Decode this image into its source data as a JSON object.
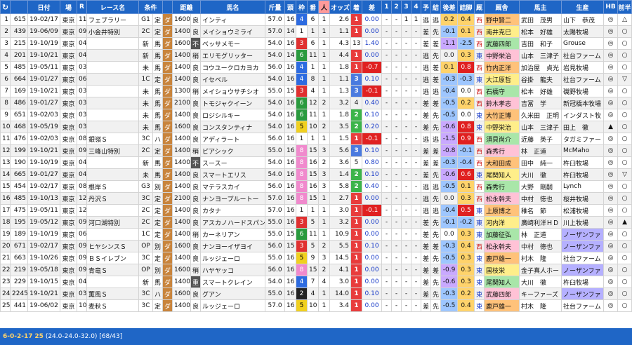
{
  "header": {
    "refresh_icon": "refresh-icon",
    "columns": [
      "",
      "",
      "日付",
      "場",
      "R",
      "レース名",
      "条件",
      "",
      "距離",
      "",
      "馬名",
      "斤量",
      "頭",
      "枠",
      "番",
      "人",
      "オッズ",
      "着",
      "差",
      "1",
      "2",
      "3",
      "4",
      "予",
      "結",
      "後差",
      "詰脚",
      "厩",
      "厩舎",
      "",
      "馬主",
      "生産",
      "HB",
      "前半",
      "後半"
    ]
  },
  "rows": [
    {
      "no": "1",
      "id": "615",
      "date": "19-02/17",
      "place": "東京",
      "r": "11",
      "race": "フェブラリー",
      "grade": "G1",
      "cond": "定",
      "surf": "ダ",
      "dist": "1600",
      "ba": "良",
      "name": "インティ",
      "kin": "57.0",
      "tou": "16",
      "waku": "4",
      "ban": "6",
      "nin": "1",
      "odds": "2.6",
      "chaku": "1",
      "sa": "0.00",
      "c1": "-",
      "c2": "-",
      "c3": "1",
      "c4": "1",
      "yo": "逃",
      "ke": "逃",
      "atosa": "0.2",
      "tsume": "0.4",
      "kyu": "西",
      "trainer": "野中賢二",
      "owner": "武田　茂男",
      "breeder": "山下　恭茂",
      "hb": "◎",
      "mae": "△",
      "ato": "▽"
    },
    {
      "no": "2",
      "id": "439",
      "date": "19-06/09",
      "place": "東京",
      "r": "09",
      "race": "小金井特別",
      "grade": "2C",
      "cond": "定",
      "surf": "ダ",
      "dist": "1400",
      "ba": "良",
      "name": "メイショウミライ",
      "kin": "57.0",
      "tou": "14",
      "waku": "1",
      "ban": "1",
      "nin": "1",
      "odds": "1.1",
      "chaku": "1",
      "sa": "0.00",
      "c1": "-",
      "c2": "-",
      "c3": "-",
      "c4": "-",
      "yo": "差",
      "ke": "先",
      "atosa": "-0.1",
      "tsume": "0.1",
      "kyu": "西",
      "trainer": "南井克巳",
      "owner": "松本　好雄",
      "breeder": "太陽牧場",
      "hb": "◎",
      "mae": "○",
      "ato": "▽"
    },
    {
      "no": "3",
      "id": "215",
      "date": "19-10/19",
      "place": "東京",
      "r": "04",
      "race": "",
      "grade": "新",
      "cond": "馬",
      "surf": "ダ",
      "dist": "1600",
      "ba": "不",
      "name": "ベッサメモー",
      "kin": "54.0",
      "tou": "16",
      "waku": "3",
      "ban": "6",
      "nin": "1",
      "odds": "4.3",
      "chaku": "13",
      "sa": "1.40",
      "c1": "-",
      "c2": "-",
      "c3": "-",
      "c4": "-",
      "yo": "差",
      "ke": "差",
      "atosa": "-1.1",
      "tsume": "-2.5",
      "kyu": "西",
      "trainer": "武藤四郎",
      "owner": "吉田　和子",
      "breeder": "Grouse",
      "hb": "◎",
      "mae": "○",
      "ato": "○"
    },
    {
      "no": "4",
      "id": "201",
      "date": "19-10/21",
      "place": "東京",
      "r": "04",
      "race": "",
      "grade": "新",
      "cond": "馬",
      "surf": "ダ",
      "dist": "1400",
      "ba": "稍",
      "name": "エリモグリッター",
      "kin": "54.0",
      "tou": "14",
      "waku": "6",
      "ban": "11",
      "nin": "1",
      "odds": "4.4",
      "chaku": "1",
      "sa": "0.00",
      "c1": "-",
      "c2": "-",
      "c3": "-",
      "c4": "-",
      "yo": "逃",
      "ke": "先",
      "atosa": "0.0",
      "tsume": "0.3",
      "kyu": "東",
      "trainer": "中野栄治",
      "owner": "山本　三津子",
      "breeder": "社台ファーム",
      "hb": "◎",
      "mae": "○",
      "ato": "○"
    },
    {
      "no": "5",
      "id": "485",
      "date": "19-05/11",
      "place": "東京",
      "r": "03",
      "race": "",
      "grade": "未",
      "cond": "馬",
      "surf": "ダ",
      "dist": "1400",
      "ba": "良",
      "name": "コウユークロカヨカ",
      "kin": "56.0",
      "tou": "16",
      "waku": "4",
      "ban": "1",
      "nin": "1",
      "odds": "1.8",
      "chaku": "1",
      "sa": "-0.7",
      "c1": "-",
      "c2": "-",
      "c3": "-",
      "c4": "-",
      "yo": "逃",
      "ke": "差",
      "atosa": "0.1",
      "tsume": "0.8",
      "kyu": "西",
      "trainer": "竹内正洋",
      "owner": "加治屋　貞光",
      "breeder": "岩見牧場",
      "hb": "◎",
      "mae": "○",
      "ato": "○"
    },
    {
      "no": "6",
      "id": "664",
      "date": "19-01/27",
      "place": "東京",
      "r": "06",
      "race": "",
      "grade": "1C",
      "cond": "定",
      "surf": "ダ",
      "dist": "1400",
      "ba": "良",
      "name": "イセベル",
      "kin": "54.0",
      "tou": "16",
      "waku": "4",
      "ban": "8",
      "nin": "1",
      "odds": "1.1",
      "chaku": "3",
      "sa": "0.10",
      "c1": "-",
      "c2": "-",
      "c3": "-",
      "c4": "-",
      "yo": "逃",
      "ke": "差",
      "atosa": "-0.3",
      "tsume": "-0.3",
      "kyu": "東",
      "trainer": "大江原哲",
      "owner": "谷掛　龍夫",
      "breeder": "社台ファーム",
      "hb": "◎",
      "mae": "▽",
      "ato": "○"
    },
    {
      "no": "7",
      "id": "169",
      "date": "19-10/21",
      "place": "東京",
      "r": "03",
      "race": "",
      "grade": "未",
      "cond": "馬",
      "surf": "ダ",
      "dist": "1300",
      "ba": "稍",
      "name": "メイショウサチシオ",
      "kin": "55.0",
      "tou": "15",
      "waku": "3",
      "ban": "4",
      "nin": "1",
      "odds": "1.3",
      "chaku": "3",
      "sa": "-0.1",
      "c1": "-",
      "c2": "-",
      "c3": "-",
      "c4": "-",
      "yo": "逃",
      "ke": "逃",
      "atosa": "-0.4",
      "tsume": "0.0",
      "kyu": "西",
      "trainer": "石橋守",
      "owner": "松本　好雄",
      "breeder": "磯野牧場",
      "hb": "◎",
      "mae": "○",
      "ato": "○"
    },
    {
      "no": "8",
      "id": "486",
      "date": "19-01/27",
      "place": "東京",
      "r": "03",
      "race": "",
      "grade": "未",
      "cond": "馬",
      "surf": "ダ",
      "dist": "2100",
      "ba": "良",
      "name": "トモジャクイーン",
      "kin": "54.0",
      "tou": "16",
      "waku": "6",
      "ban": "12",
      "nin": "2",
      "odds": "3.2",
      "chaku": "4",
      "sa": "0.40",
      "c1": "-",
      "c2": "-",
      "c3": "-",
      "c4": "-",
      "yo": "差",
      "ke": "差",
      "atosa": "-0.5",
      "tsume": "0.2",
      "kyu": "西",
      "trainer": "鈴木孝志",
      "owner": "吉冨　学",
      "breeder": "新冠橋本牧場",
      "hb": "◎",
      "mae": "○",
      "ato": "▲"
    },
    {
      "no": "9",
      "id": "651",
      "date": "19-02/03",
      "place": "東京",
      "r": "03",
      "race": "",
      "grade": "未",
      "cond": "馬",
      "surf": "ダ",
      "dist": "1400",
      "ba": "良",
      "name": "ロジシルキー",
      "kin": "54.0",
      "tou": "16",
      "waku": "6",
      "ban": "11",
      "nin": "1",
      "odds": "1.8",
      "chaku": "2",
      "sa": "0.10",
      "c1": "-",
      "c2": "-",
      "c3": "-",
      "c4": "-",
      "yo": "差",
      "ke": "先",
      "atosa": "-0.5",
      "tsume": "0.0",
      "kyu": "東",
      "trainer": "大竹正博",
      "owner": "久米田　正明",
      "breeder": "インダスト牧",
      "hb": "◎",
      "mae": "○",
      "ato": "▽"
    },
    {
      "no": "10",
      "id": "468",
      "date": "19-05/19",
      "place": "東京",
      "r": "03",
      "race": "",
      "grade": "未",
      "cond": "馬",
      "surf": "ダ",
      "dist": "1600",
      "ba": "良",
      "name": "コンスタンティナ",
      "kin": "54.0",
      "tou": "16",
      "waku": "5",
      "ban": "10",
      "nin": "2",
      "odds": "3.5",
      "chaku": "2",
      "sa": "0.20",
      "c1": "-",
      "c2": "-",
      "c3": "-",
      "c4": "-",
      "yo": "差",
      "ke": "先",
      "atosa": "-0.6",
      "tsume": "0.8",
      "kyu": "東",
      "trainer": "中野栄治",
      "owner": "山本　三津子",
      "breeder": "田上　徹",
      "hb": "▲",
      "mae": "○",
      "ato": "▲"
    },
    {
      "no": "11",
      "id": "476",
      "date": "19-02/03",
      "place": "東京",
      "r": "08",
      "race": "銀嶺Ｓ",
      "grade": "3C",
      "cond": "ハ",
      "surf": "ダ",
      "dist": "1400",
      "ba": "良",
      "name": "アディラート",
      "kin": "56.0",
      "tou": "16",
      "waku": "1",
      "ban": "1",
      "nin": "1",
      "odds": "1.5",
      "chaku": "1",
      "sa": "-0.1",
      "c1": "-",
      "c2": "-",
      "c3": "-",
      "c4": "-",
      "yo": "逃",
      "ke": "逃",
      "atosa": "-1.5",
      "tsume": "0.9",
      "kyu": "西",
      "trainer": "須貝尚介",
      "owner": "近藤　英子",
      "breeder": "タガミファー",
      "hb": "◎",
      "mae": "○",
      "ato": "▽"
    },
    {
      "no": "12",
      "id": "199",
      "date": "19-10/21",
      "place": "東京",
      "r": "09",
      "race": "三峰山特別",
      "grade": "2C",
      "cond": "定",
      "surf": "ダ",
      "dist": "1400",
      "ba": "稍",
      "name": "ピアシック",
      "kin": "55.0",
      "tou": "16",
      "waku": "8",
      "ban": "15",
      "nin": "3",
      "odds": "5.6",
      "chaku": "3",
      "sa": "0.10",
      "c1": "-",
      "c2": "-",
      "c3": "-",
      "c4": "-",
      "yo": "差",
      "ke": "差",
      "atosa": "-0.8",
      "tsume": "-0.1",
      "kyu": "西",
      "trainer": "森秀行",
      "owner": "林　正道",
      "breeder": "McMaho",
      "hb": "◎",
      "mae": "○",
      "ato": "○"
    },
    {
      "no": "13",
      "id": "190",
      "date": "19-10/19",
      "place": "東京",
      "r": "04",
      "race": "",
      "grade": "新",
      "cond": "馬",
      "surf": "ダ",
      "dist": "1400",
      "ba": "不",
      "name": "スースー",
      "kin": "54.0",
      "tou": "16",
      "waku": "8",
      "ban": "16",
      "nin": "2",
      "odds": "3.6",
      "chaku": "5",
      "sa": "0.80",
      "c1": "-",
      "c2": "-",
      "c3": "-",
      "c4": "-",
      "yo": "差",
      "ke": "差",
      "atosa": "-0.3",
      "tsume": "-0.4",
      "kyu": "西",
      "trainer": "大和田成",
      "owner": "田中　純一",
      "breeder": "杵臼牧場",
      "hb": "◎",
      "mae": "○",
      "ato": "○"
    },
    {
      "no": "14",
      "id": "665",
      "date": "19-01/27",
      "place": "東京",
      "r": "04",
      "race": "",
      "grade": "未",
      "cond": "馬",
      "surf": "ダ",
      "dist": "1400",
      "ba": "良",
      "name": "スマートエリス",
      "kin": "54.0",
      "tou": "16",
      "waku": "8",
      "ban": "15",
      "nin": "3",
      "odds": "1.4",
      "chaku": "2",
      "sa": "0.10",
      "c1": "-",
      "c2": "-",
      "c3": "-",
      "c4": "-",
      "yo": "差",
      "ke": "先",
      "atosa": "-0.6",
      "tsume": "0.6",
      "kyu": "東",
      "trainer": "尾関知人",
      "owner": "大川　徹",
      "breeder": "杵臼牧場",
      "hb": "◎",
      "mae": "▽",
      "ato": "▲"
    },
    {
      "no": "15",
      "id": "454",
      "date": "19-02/17",
      "place": "東京",
      "r": "08",
      "race": "根岸Ｓ",
      "grade": "G3",
      "cond": "別",
      "surf": "ダ",
      "dist": "1400",
      "ba": "良",
      "name": "マテラスカイ",
      "kin": "56.0",
      "tou": "16",
      "waku": "8",
      "ban": "16",
      "nin": "3",
      "odds": "5.8",
      "chaku": "2",
      "sa": "0.40",
      "c1": "-",
      "c2": "-",
      "c3": "-",
      "c4": "-",
      "yo": "逃",
      "ke": "逃",
      "atosa": "-0.5",
      "tsume": "0.1",
      "kyu": "西",
      "trainer": "森秀行",
      "owner": "大野　剛嗣",
      "breeder": "Lynch",
      "hb": "◎",
      "mae": "○",
      "ato": "○"
    },
    {
      "no": "16",
      "id": "485",
      "date": "19-10/13",
      "place": "東京",
      "r": "12",
      "race": "丹沢Ｓ",
      "grade": "3C",
      "cond": "定",
      "surf": "ダ",
      "dist": "2100",
      "ba": "良",
      "name": "ナンヨープルートー",
      "kin": "57.0",
      "tou": "16",
      "waku": "8",
      "ban": "15",
      "nin": "1",
      "odds": "2.7",
      "chaku": "1",
      "sa": "0.00",
      "c1": "-",
      "c2": "-",
      "c3": "-",
      "c4": "-",
      "yo": "逃",
      "ke": "先",
      "atosa": "0.0",
      "tsume": "0.3",
      "kyu": "西",
      "trainer": "松永幹夫",
      "owner": "中村　徳也",
      "breeder": "桜井牧場",
      "hb": "◎",
      "mae": "○",
      "ato": "○"
    },
    {
      "no": "17",
      "id": "475",
      "date": "19-05/11",
      "place": "東京",
      "r": "12",
      "race": "",
      "grade": "2C",
      "cond": "定",
      "surf": "ダ",
      "dist": "1400",
      "ba": "良",
      "name": "カタナ",
      "kin": "57.0",
      "tou": "16",
      "waku": "1",
      "ban": "1",
      "nin": "1",
      "odds": "3.0",
      "chaku": "1",
      "sa": "-0.1",
      "c1": "-",
      "c2": "-",
      "c3": "-",
      "c4": "-",
      "yo": "逃",
      "ke": "逃",
      "atosa": "-0.4",
      "tsume": "0.5",
      "kyu": "東",
      "trainer": "上原博之",
      "owner": "稚名　節",
      "breeder": "松浦牧場",
      "hb": "◎",
      "mae": "○",
      "ato": "○"
    },
    {
      "no": "18",
      "id": "195",
      "date": "19-05/12",
      "place": "東京",
      "r": "09",
      "race": "河口湖特別",
      "grade": "2C",
      "cond": "定",
      "surf": "ダ",
      "dist": "1400",
      "ba": "良",
      "name": "アスカノハードスパン",
      "kin": "55.0",
      "tou": "16",
      "waku": "3",
      "ban": "5",
      "nin": "1",
      "odds": "3.2",
      "chaku": "1",
      "sa": "0.00",
      "c1": "-",
      "c2": "-",
      "c3": "-",
      "c4": "-",
      "yo": "差",
      "ke": "先",
      "atosa": "-0.1",
      "tsume": "-0.2",
      "kyu": "東",
      "trainer": "河内洋",
      "owner": "廣崎利洋ＨＤ",
      "breeder": "川上牧場",
      "hb": "◎",
      "mae": "▲",
      "ato": "▽"
    },
    {
      "no": "19",
      "id": "189",
      "date": "19-10/19",
      "place": "東京",
      "r": "06",
      "race": "",
      "grade": "1C",
      "cond": "定",
      "surf": "ダ",
      "dist": "1400",
      "ba": "稍",
      "name": "カーネリアン",
      "kin": "55.0",
      "tou": "15",
      "waku": "6",
      "ban": "11",
      "nin": "1",
      "odds": "10.9",
      "chaku": "1",
      "sa": "0.00",
      "c1": "-",
      "c2": "-",
      "c3": "-",
      "c4": "-",
      "yo": "差",
      "ke": "先",
      "atosa": "0.0",
      "tsume": "0.3",
      "kyu": "東",
      "trainer": "加藤征弘",
      "owner": "林　正道",
      "breeder": "ノーザンファ",
      "hb": "◎",
      "mae": "○",
      "ato": "▲"
    },
    {
      "no": "20",
      "id": "671",
      "date": "19-02/17",
      "place": "東京",
      "r": "09",
      "race": "ヒヤシンスＳ",
      "grade": "OP",
      "cond": "別",
      "surf": "ダ",
      "dist": "1600",
      "ba": "良",
      "name": "ナンヨーイザヨイ",
      "kin": "56.0",
      "tou": "15",
      "waku": "3",
      "ban": "5",
      "nin": "2",
      "odds": "5.5",
      "chaku": "1",
      "sa": "0.10",
      "c1": "-",
      "c2": "-",
      "c3": "-",
      "c4": "-",
      "yo": "差",
      "ke": "差",
      "atosa": "-0.3",
      "tsume": "0.4",
      "kyu": "西",
      "trainer": "松永幹夫",
      "owner": "中村　徳也",
      "breeder": "ノーザンファ",
      "hb": "◎",
      "mae": "○",
      "ato": "○"
    },
    {
      "no": "21",
      "id": "663",
      "date": "19-10/26",
      "place": "東京",
      "r": "09",
      "race": "ＢＳイレブン",
      "grade": "3C",
      "cond": "定",
      "surf": "ダ",
      "dist": "1400",
      "ba": "良",
      "name": "ルッジェーロ",
      "kin": "55.0",
      "tou": "16",
      "waku": "5",
      "ban": "9",
      "nin": "3",
      "odds": "14.5",
      "chaku": "1",
      "sa": "0.00",
      "c1": "-",
      "c2": "-",
      "c3": "-",
      "c4": "-",
      "yo": "差",
      "ke": "先",
      "atosa": "-0.5",
      "tsume": "0.3",
      "kyu": "東",
      "trainer": "鹿戸雄一",
      "owner": "村木　隆",
      "breeder": "社台ファーム",
      "hb": "◎",
      "mae": "○",
      "ato": "▽"
    },
    {
      "no": "22",
      "id": "219",
      "date": "19-05/18",
      "place": "東京",
      "r": "09",
      "race": "青竜Ｓ",
      "grade": "OP",
      "cond": "別",
      "surf": "ダ",
      "dist": "1600",
      "ba": "稍",
      "name": "ハヤヤッコ",
      "kin": "56.0",
      "tou": "16",
      "waku": "8",
      "ban": "15",
      "nin": "2",
      "odds": "4.1",
      "chaku": "1",
      "sa": "0.00",
      "c1": "-",
      "c2": "-",
      "c3": "-",
      "c4": "-",
      "yo": "差",
      "ke": "差",
      "atosa": "-0.9",
      "tsume": "0.3",
      "kyu": "東",
      "trainer": "国枝栄",
      "owner": "金子真人ホー",
      "breeder": "ノーザンファ",
      "hb": "◎",
      "mae": "○",
      "ato": "▽"
    },
    {
      "no": "23",
      "id": "229",
      "date": "19-10/15",
      "place": "東京",
      "r": "04",
      "race": "",
      "grade": "新",
      "cond": "馬",
      "surf": "ダ",
      "dist": "1400",
      "ba": "重",
      "name": "スマートクレイン",
      "kin": "54.0",
      "tou": "16",
      "waku": "4",
      "ban": "7",
      "nin": "4",
      "odds": "3.0",
      "chaku": "1",
      "sa": "0.00",
      "c1": "-",
      "c2": "-",
      "c3": "-",
      "c4": "-",
      "yo": "差",
      "ke": "先",
      "atosa": "-0.6",
      "tsume": "0.3",
      "kyu": "東",
      "trainer": "尾関知人",
      "owner": "大川　徹",
      "breeder": "杵臼牧場",
      "hb": "◎",
      "mae": "○",
      "ato": "▲"
    },
    {
      "no": "24",
      "id": "2245",
      "date": "19-10/21",
      "place": "東京",
      "r": "03",
      "race": "薫風Ｓ",
      "grade": "3C",
      "cond": "ハ",
      "surf": "ダ",
      "dist": "1600",
      "ba": "良",
      "name": "グアン",
      "kin": "55.0",
      "tou": "16",
      "waku": "2",
      "ban": "4",
      "nin": "1",
      "odds": "14.0",
      "chaku": "1",
      "sa": "0.10",
      "c1": "-",
      "c2": "-",
      "c3": "-",
      "c4": "-",
      "yo": "差",
      "ke": "先",
      "atosa": "-0.3",
      "tsume": "0.2",
      "kyu": "東",
      "trainer": "武藤四郎",
      "owner": "キーファーズ",
      "breeder": "ノーザンファ",
      "hb": "◎",
      "mae": "○",
      "ato": "○"
    },
    {
      "no": "25",
      "id": "441",
      "date": "19-06/02",
      "place": "東京",
      "r": "10",
      "race": "麦秋Ｓ",
      "grade": "3C",
      "cond": "定",
      "surf": "ダ",
      "dist": "1400",
      "ba": "良",
      "name": "ルッジェーロ",
      "kin": "57.0",
      "tou": "16",
      "waku": "5",
      "ban": "10",
      "nin": "1",
      "odds": "3.4",
      "chaku": "1",
      "sa": "0.00",
      "c1": "-",
      "c2": "-",
      "c3": "-",
      "c4": "-",
      "yo": "差",
      "ke": "先",
      "atosa": "-0.5",
      "tsume": "0.4",
      "kyu": "東",
      "trainer": "鹿戸雄一",
      "owner": "村木　隆",
      "breeder": "社台ファーム",
      "hb": "◎",
      "mae": "○",
      "ato": "○"
    }
  ],
  "footer": {
    "prefix": "6-0-2-17",
    "count": "25",
    "detail": "(24.0-24.0-32.0) [68/43]"
  },
  "colors": {
    "header_bg": "#1f66c6",
    "dirt": "#c8843c"
  }
}
